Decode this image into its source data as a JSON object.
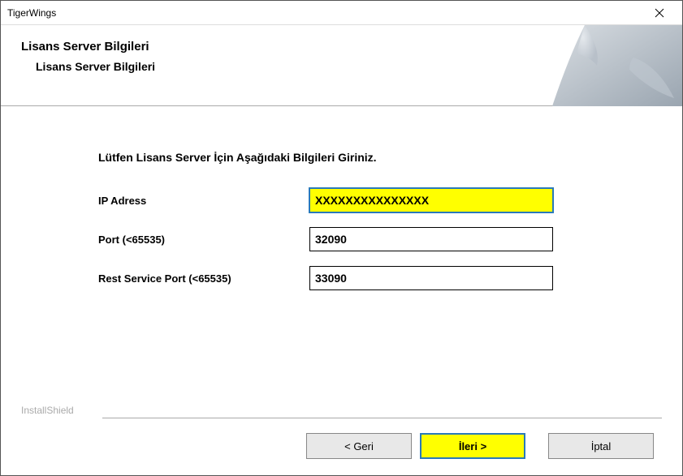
{
  "window": {
    "title": "TigerWings"
  },
  "header": {
    "title": "Lisans Server Bilgileri",
    "subtitle": "Lisans Server Bilgileri"
  },
  "content": {
    "instruction": "Lütfen Lisans Server İçin Aşağıdaki Bilgileri Giriniz.",
    "fields": {
      "ip": {
        "label": "IP Adress",
        "value": "XXXXXXXXXXXXXXX"
      },
      "port": {
        "label": "Port (<65535)",
        "value": "32090"
      },
      "restPort": {
        "label": "Rest Service Port (<65535)",
        "value": "33090"
      }
    }
  },
  "footer": {
    "brand": "InstallShield",
    "buttons": {
      "back": "< Geri",
      "next": "İleri >",
      "cancel": "İptal"
    }
  }
}
